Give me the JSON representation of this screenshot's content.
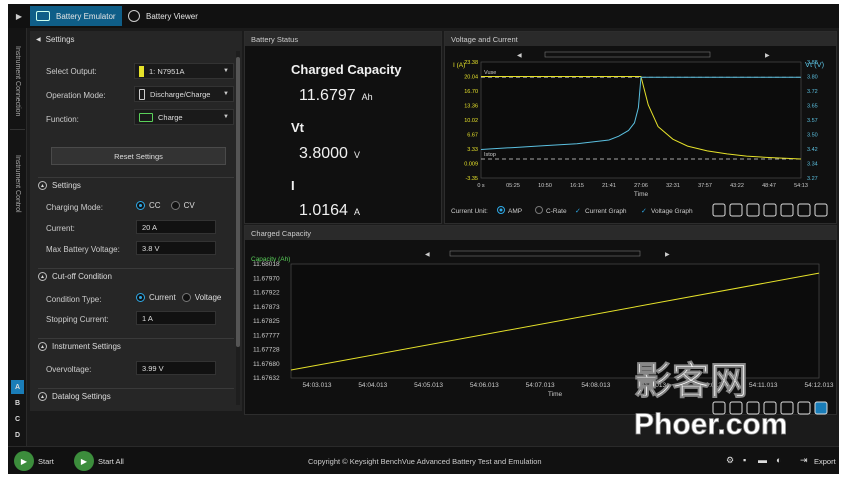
{
  "tabs": [
    {
      "label": "Battery Emulator",
      "icon": "battery-icon",
      "active": true
    },
    {
      "label": "Battery Viewer",
      "icon": "document-icon",
      "active": false
    }
  ],
  "side_tabs": {
    "connection": "Instrument Connection",
    "control": "Instrument Control"
  },
  "slots": [
    "A",
    "B",
    "C",
    "D"
  ],
  "settings": {
    "header": "Settings",
    "select_output_label": "Select Output:",
    "select_output_value": "1: N7951A",
    "operation_mode_label": "Operation Mode:",
    "operation_mode_value": "Discharge/Charge",
    "function_label": "Function:",
    "function_value": "Charge",
    "reset_label": "Reset Settings",
    "settings_section": "Settings",
    "charging_mode_label": "Charging Mode:",
    "mode_cc": "CC",
    "mode_cv": "CV",
    "current_label": "Current:",
    "current_value": "20 A",
    "max_voltage_label": "Max Battery Voltage:",
    "max_voltage_value": "3.8 V",
    "cutoff_section": "Cut-off Condition",
    "condition_type_label": "Condition Type:",
    "cond_current": "Current",
    "cond_voltage": "Voltage",
    "stopping_current_label": "Stopping Current:",
    "stopping_current_value": "1 A",
    "instrument_section": "Instrument Settings",
    "overvoltage_label": "Overvoltage:",
    "overvoltage_value": "3.99 V",
    "datalog_section": "Datalog Settings"
  },
  "status": {
    "title": "Battery Status",
    "capacity_label": "Charged Capacity",
    "capacity_value": "11.6797",
    "capacity_unit": "Ah",
    "vt_label": "Vt",
    "vt_value": "3.8000",
    "vt_unit": "V",
    "i_label": "I",
    "i_value": "1.0164",
    "i_unit": "A"
  },
  "vc_panel": {
    "title": "Voltage and Current",
    "legend_unit_label": "Current Unit:",
    "opt_amp": "AMP",
    "opt_crate": "C-Rate",
    "opt_current_graph": "Current Graph",
    "opt_voltage_graph": "Voltage Graph"
  },
  "cap_panel": {
    "title": "Charged Capacity"
  },
  "bottom": {
    "start_label": "Start",
    "start_all_label": "Start All",
    "copyright": "Copyright © Keysight BenchVue Advanced Battery Test and Emulation",
    "export_label": "Export"
  },
  "watermark": {
    "line1": "影客网",
    "line2": "Phoer.com"
  },
  "colors": {
    "accent": "#0f5e88",
    "current_trace": "#e6e22a",
    "voltage_trace": "#5bc0e0",
    "capacity_trace": "#e6e22a"
  },
  "chart_data": [
    {
      "type": "line",
      "title": "Voltage and Current",
      "xlabel": "Time",
      "ylabel": "I (A)",
      "y2label": "Vt (V)",
      "x_ticks": [
        "0 s",
        "05:25",
        "10:50",
        "16:15",
        "21:41",
        "27:06",
        "32:31",
        "37:57",
        "43:22",
        "48:47",
        "54:13"
      ],
      "y_ticks": [
        "23.38",
        "20.04",
        "16.70",
        "13.36",
        "10.02",
        "6.67",
        "3.33",
        "0.009",
        "-3.35"
      ],
      "y2_ticks": [
        "3.88",
        "3.80",
        "3.72",
        "3.65",
        "3.57",
        "3.50",
        "3.42",
        "3.34",
        "3.27"
      ],
      "ylim": [
        -3.35,
        23.38
      ],
      "y2lim": [
        3.27,
        3.88
      ],
      "annotations": [
        "Vuse",
        "Istop"
      ],
      "series": [
        {
          "name": "Current Graph",
          "x": [
            0,
            325,
            650,
            975,
            1301,
            1400,
            1500,
            1560,
            1600,
            1626,
            1700,
            1800,
            1950,
            2100,
            2300,
            2500,
            2700,
            2900,
            3253
          ],
          "values": [
            20.04,
            20.04,
            20.04,
            20.04,
            20.04,
            20.04,
            20.04,
            20.04,
            20.04,
            20.04,
            13.5,
            8.5,
            5.6,
            4.0,
            2.9,
            2.2,
            1.7,
            1.4,
            1.02
          ]
        },
        {
          "name": "Voltage Graph",
          "x": [
            0,
            325,
            650,
            975,
            1301,
            1400,
            1500,
            1560,
            1600,
            1626,
            3253
          ],
          "values": [
            3.42,
            3.43,
            3.44,
            3.45,
            3.47,
            3.49,
            3.52,
            3.56,
            3.64,
            3.8,
            3.8
          ]
        }
      ]
    },
    {
      "type": "line",
      "title": "Charged Capacity",
      "xlabel": "Time",
      "ylabel": "Capacity (Ah)",
      "x_ticks": [
        "54:03.013",
        "54:04.013",
        "54:05.013",
        "54:06.013",
        "54:07.013",
        "54:08.013",
        "54:09.013",
        "54:10.013",
        "54:11.013",
        "54:12.013"
      ],
      "y_ticks": [
        "11.68018",
        "11.67970",
        "11.67922",
        "11.67873",
        "11.67825",
        "11.67777",
        "11.67728",
        "11.67680",
        "11.67632"
      ],
      "ylim": [
        11.67632,
        11.68018
      ],
      "series": [
        {
          "name": "Capacity",
          "x": [
            0,
            9.4
          ],
          "values": [
            11.67659,
            11.67987
          ]
        }
      ]
    }
  ]
}
